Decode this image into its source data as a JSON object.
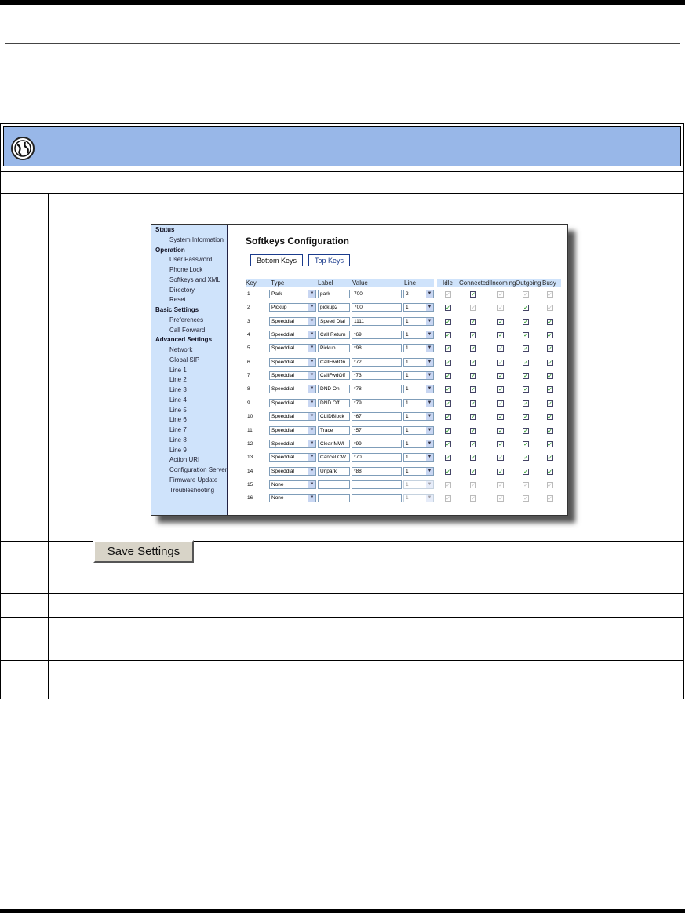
{
  "ui": {
    "title": "Softkeys Configuration",
    "tabs": [
      "Bottom Keys",
      "Top Keys"
    ],
    "save_label": "Save Settings",
    "headers": [
      "Key",
      "Type",
      "Label",
      "Value",
      "Line",
      "Idle",
      "Connected",
      "Incoming",
      "Outgoing",
      "Busy"
    ],
    "sidebar": [
      {
        "label": "Status",
        "h": true
      },
      {
        "label": "System Information",
        "h": false
      },
      {
        "label": "Operation",
        "h": true
      },
      {
        "label": "User Password",
        "h": false
      },
      {
        "label": "Phone Lock",
        "h": false
      },
      {
        "label": "Softkeys and XML",
        "h": false
      },
      {
        "label": "Directory",
        "h": false
      },
      {
        "label": "Reset",
        "h": false
      },
      {
        "label": "Basic Settings",
        "h": true
      },
      {
        "label": "Preferences",
        "h": false
      },
      {
        "label": "Call Forward",
        "h": false
      },
      {
        "label": "Advanced Settings",
        "h": true
      },
      {
        "label": "Network",
        "h": false
      },
      {
        "label": "Global SIP",
        "h": false
      },
      {
        "label": "Line 1",
        "h": false
      },
      {
        "label": "Line 2",
        "h": false
      },
      {
        "label": "Line 3",
        "h": false
      },
      {
        "label": "Line 4",
        "h": false
      },
      {
        "label": "Line 5",
        "h": false
      },
      {
        "label": "Line 6",
        "h": false
      },
      {
        "label": "Line 7",
        "h": false
      },
      {
        "label": "Line 8",
        "h": false
      },
      {
        "label": "Line 9",
        "h": false
      },
      {
        "label": "Action URI",
        "h": false
      },
      {
        "label": "Configuration Server",
        "h": false
      },
      {
        "label": "Firmware Update",
        "h": false
      },
      {
        "label": "Troubleshooting",
        "h": false
      }
    ],
    "rows": [
      {
        "key": "1",
        "type": "Park",
        "label": "park",
        "value": "700",
        "line": "2",
        "states": [
          0,
          1,
          0,
          0,
          0
        ]
      },
      {
        "key": "2",
        "type": "Pickup",
        "label": "pickup2",
        "value": "700",
        "line": "1",
        "states": [
          1,
          0,
          0,
          1,
          0
        ]
      },
      {
        "key": "3",
        "type": "Speeddial",
        "label": "Speed Dial",
        "value": "1111",
        "line": "1",
        "states": [
          1,
          1,
          1,
          1,
          1
        ]
      },
      {
        "key": "4",
        "type": "Speeddial",
        "label": "Call Return",
        "value": "*69",
        "line": "1",
        "states": [
          1,
          1,
          1,
          1,
          1
        ]
      },
      {
        "key": "5",
        "type": "Speeddial",
        "label": "Pickup",
        "value": "*98",
        "line": "1",
        "states": [
          1,
          1,
          1,
          1,
          1
        ]
      },
      {
        "key": "6",
        "type": "Speeddial",
        "label": "CallFwdOn",
        "value": "*72",
        "line": "1",
        "states": [
          1,
          1,
          1,
          1,
          1
        ]
      },
      {
        "key": "7",
        "type": "Speeddial",
        "label": "CallFwdOff",
        "value": "*73",
        "line": "1",
        "states": [
          1,
          1,
          1,
          1,
          1
        ]
      },
      {
        "key": "8",
        "type": "Speeddial",
        "label": "DND On",
        "value": "*78",
        "line": "1",
        "states": [
          1,
          1,
          1,
          1,
          1
        ]
      },
      {
        "key": "9",
        "type": "Speeddial",
        "label": "DND Off",
        "value": "*79",
        "line": "1",
        "states": [
          1,
          1,
          1,
          1,
          1
        ]
      },
      {
        "key": "10",
        "type": "Speeddial",
        "label": "CLIDBlock",
        "value": "*67",
        "line": "1",
        "states": [
          1,
          1,
          1,
          1,
          1
        ]
      },
      {
        "key": "11",
        "type": "Speeddial",
        "label": "Trace",
        "value": "*57",
        "line": "1",
        "states": [
          1,
          1,
          1,
          1,
          1
        ]
      },
      {
        "key": "12",
        "type": "Speeddial",
        "label": "Clear MWI",
        "value": "*99",
        "line": "1",
        "states": [
          1,
          1,
          1,
          1,
          1
        ]
      },
      {
        "key": "13",
        "type": "Speeddial",
        "label": "Cancel CW",
        "value": "*70",
        "line": "1",
        "states": [
          1,
          1,
          1,
          1,
          1
        ]
      },
      {
        "key": "14",
        "type": "Speeddial",
        "label": "Unpark",
        "value": "*88",
        "line": "1",
        "states": [
          1,
          1,
          1,
          1,
          1
        ]
      },
      {
        "key": "15",
        "type": "None",
        "label": "",
        "value": "",
        "line": "1",
        "states": [
          0,
          0,
          0,
          0,
          0
        ]
      },
      {
        "key": "16",
        "type": "None",
        "label": "",
        "value": "",
        "line": "1",
        "states": [
          0,
          0,
          0,
          0,
          0
        ]
      }
    ]
  }
}
